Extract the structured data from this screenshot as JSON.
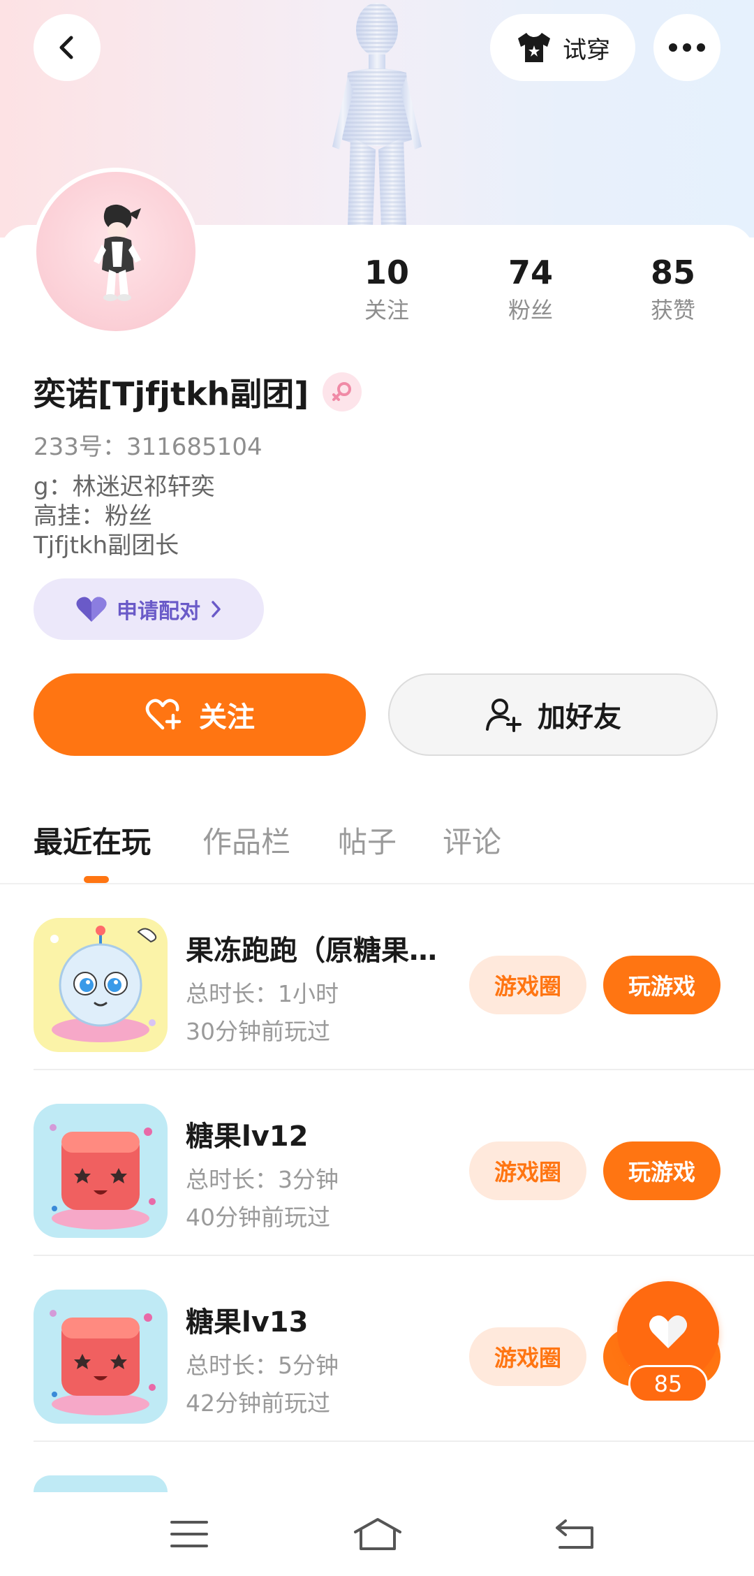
{
  "header": {
    "try_on_label": "试穿",
    "back_icon": "chevron-left-icon",
    "more_icon": "more-dots-icon",
    "tshirt_icon": "tshirt-icon"
  },
  "profile": {
    "nickname": "奕诺[Tjfjtkh副团]",
    "gender_icon": "female-icon",
    "user_id": "233号：311685104",
    "bio_lines": [
      "g：林迷迟祁轩奕",
      "高挂：粉丝",
      "Tjfjtkh副团长"
    ],
    "pair_label": "申请配对"
  },
  "stats": [
    {
      "value": "10",
      "label": "关注"
    },
    {
      "value": "74",
      "label": "粉丝"
    },
    {
      "value": "85",
      "label": "获赞"
    }
  ],
  "actions": {
    "follow_label": "关注",
    "add_friend_label": "加好友"
  },
  "tabs": [
    {
      "label": "最近在玩",
      "active": true
    },
    {
      "label": "作品栏",
      "active": false
    },
    {
      "label": "帖子",
      "active": false
    },
    {
      "label": "评论",
      "active": false
    }
  ],
  "games": [
    {
      "title": "果冻跑跑（原糖果…",
      "duration": "总时长：1小时",
      "last_played": "30分钟前玩过",
      "circle_label": "游戏圈",
      "play_label": "玩游戏"
    },
    {
      "title": "糖果lv12",
      "duration": "总时长：3分钟",
      "last_played": "40分钟前玩过",
      "circle_label": "游戏圈",
      "play_label": "玩游戏"
    },
    {
      "title": "糖果lv13",
      "duration": "总时长：5分钟",
      "last_played": "42分钟前玩过",
      "circle_label": "游戏圈",
      "play_label": "玩游戏"
    }
  ],
  "like_fab": {
    "count": "85"
  },
  "colors": {
    "accent": "#ff7512",
    "pill_bg": "#ffe9dc",
    "pair_bg": "#ece8fa",
    "pair_text": "#6a5ac8"
  },
  "navbar": {
    "menu_icon": "menu-icon",
    "home_icon": "home-icon",
    "back_icon": "back-arrow-icon"
  }
}
